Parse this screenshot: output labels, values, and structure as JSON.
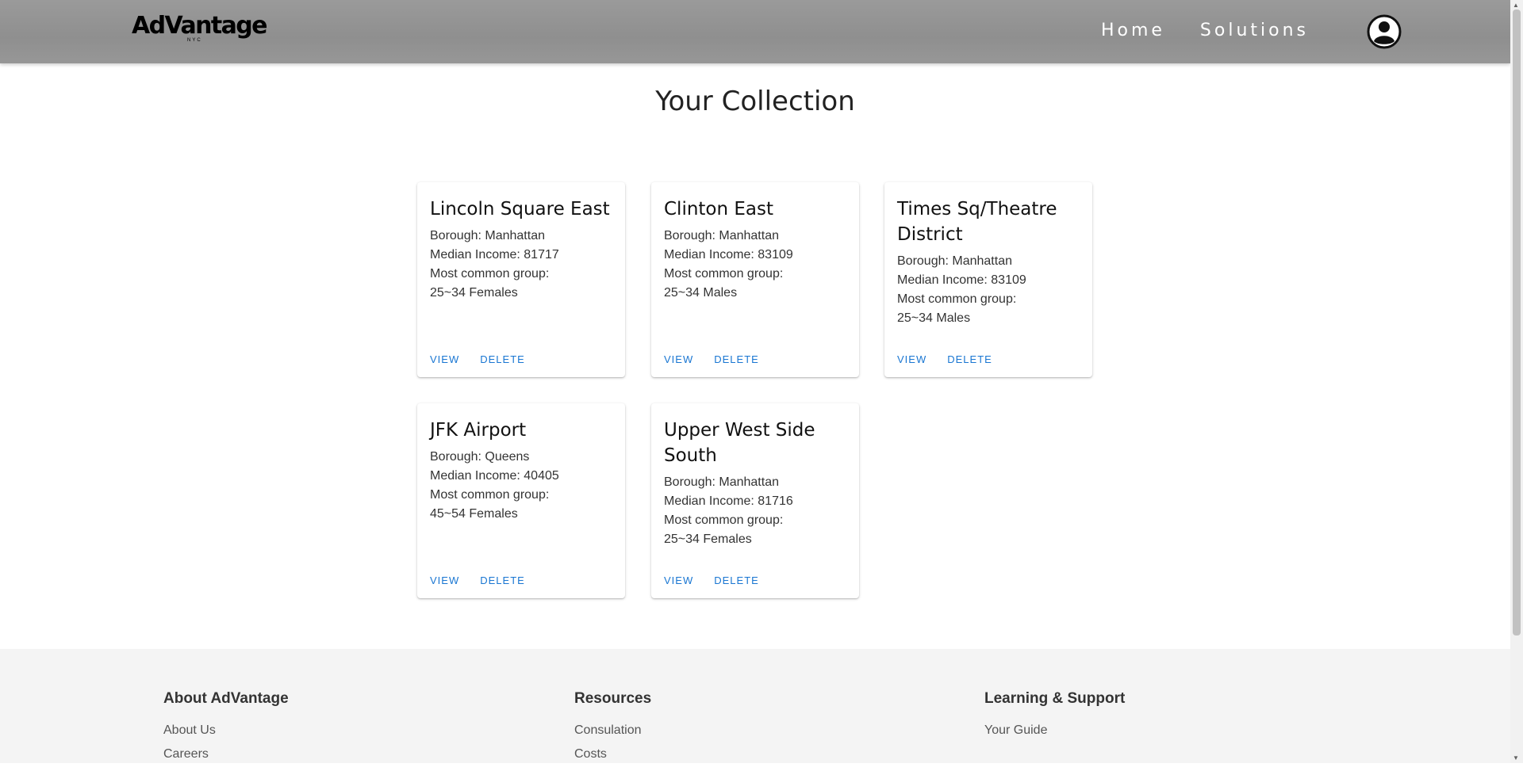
{
  "header": {
    "logo_text": "AdVantage",
    "logo_sub": "NYC",
    "nav": [
      "Home",
      "Solutions"
    ]
  },
  "page": {
    "title": "Your Collection"
  },
  "cards": [
    {
      "title": "Lincoln Square East",
      "borough": "Borough: Manhattan",
      "income": "Median Income: 81717",
      "group_label": "Most common group:",
      "group": "25~34 Females",
      "view": "VIEW",
      "delete": "DELETE"
    },
    {
      "title": "Clinton East",
      "borough": "Borough: Manhattan",
      "income": "Median Income: 83109",
      "group_label": "Most common group:",
      "group": "25~34 Males",
      "view": "VIEW",
      "delete": "DELETE"
    },
    {
      "title": "Times Sq/Theatre District",
      "borough": "Borough: Manhattan",
      "income": "Median Income: 83109",
      "group_label": "Most common group:",
      "group": "25~34 Males",
      "view": "VIEW",
      "delete": "DELETE"
    },
    {
      "title": "JFK Airport",
      "borough": "Borough: Queens",
      "income": "Median Income: 40405",
      "group_label": "Most common group:",
      "group": "45~54 Females",
      "view": "VIEW",
      "delete": "DELETE"
    },
    {
      "title": "Upper West Side South",
      "borough": "Borough: Manhattan",
      "income": "Median Income: 81716",
      "group_label": "Most common group:",
      "group": "25~34 Females",
      "view": "VIEW",
      "delete": "DELETE"
    }
  ],
  "footer": {
    "columns": [
      {
        "heading": "About AdVantage",
        "links": [
          "About Us",
          "Careers"
        ]
      },
      {
        "heading": "Resources",
        "links": [
          "Consulation",
          "Costs"
        ]
      },
      {
        "heading": "Learning & Support",
        "links": [
          "Your Guide"
        ]
      }
    ]
  },
  "icons": {
    "avatar": "account-circle-icon"
  },
  "colors": {
    "header_bg": "#959595",
    "link_blue": "#1976d2",
    "footer_bg": "#f4f4f4"
  }
}
